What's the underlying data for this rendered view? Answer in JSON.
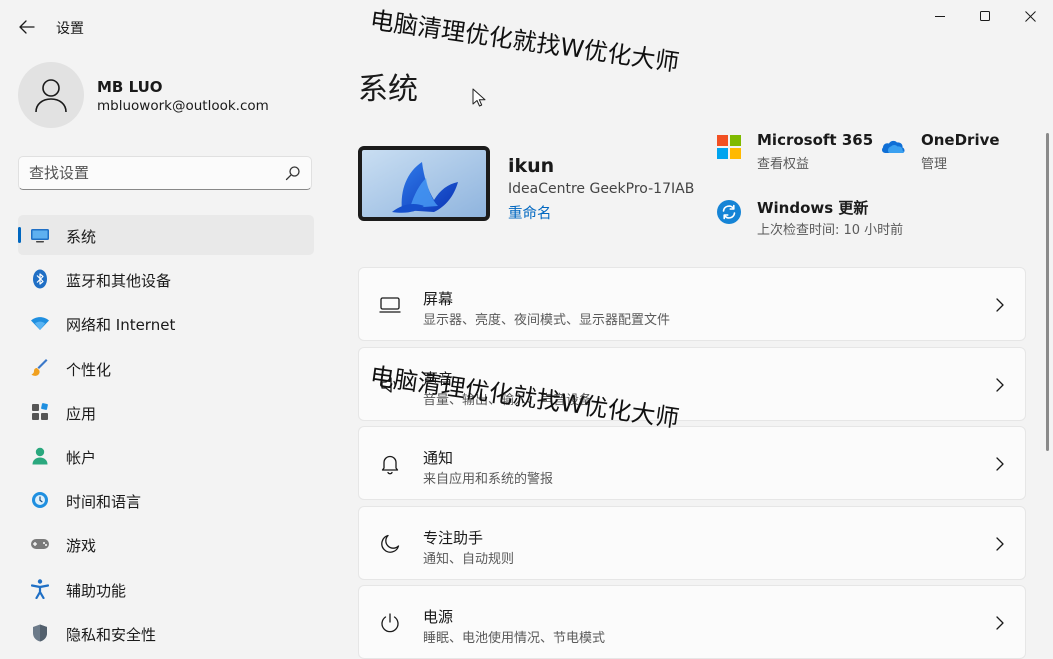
{
  "window": {
    "title": "设置"
  },
  "user": {
    "name": "MB LUO",
    "email": "mbluowork@outlook.com"
  },
  "search": {
    "placeholder": "查找设置"
  },
  "sidebar": {
    "items": [
      {
        "label": "系统",
        "icon": "monitor-icon"
      },
      {
        "label": "蓝牙和其他设备",
        "icon": "bluetooth-icon"
      },
      {
        "label": "网络和 Internet",
        "icon": "wifi-icon"
      },
      {
        "label": "个性化",
        "icon": "brush-icon"
      },
      {
        "label": "应用",
        "icon": "apps-icon"
      },
      {
        "label": "帐户",
        "icon": "person-icon"
      },
      {
        "label": "时间和语言",
        "icon": "globe-clock-icon"
      },
      {
        "label": "游戏",
        "icon": "gamepad-icon"
      },
      {
        "label": "辅助功能",
        "icon": "accessibility-icon"
      },
      {
        "label": "隐私和安全性",
        "icon": "shield-icon"
      }
    ]
  },
  "main": {
    "title": "系统",
    "device": {
      "name": "ikun",
      "model": "IdeaCentre GeekPro-17IAB",
      "rename": "重命名"
    },
    "tiles": {
      "microsoft365": {
        "title": "Microsoft 365",
        "subtitle": "查看权益"
      },
      "onedrive": {
        "title": "OneDrive",
        "subtitle": "管理"
      },
      "windows_update": {
        "title": "Windows 更新",
        "subtitle": "上次检查时间: 10 小时前"
      }
    },
    "cards": [
      {
        "title": "屏幕",
        "subtitle": "显示器、亮度、夜间模式、显示器配置文件",
        "icon": "display-icon"
      },
      {
        "title": "声音",
        "subtitle": "音量、输出、输入、声音设备",
        "icon": "speaker-icon"
      },
      {
        "title": "通知",
        "subtitle": "来自应用和系统的警报",
        "icon": "bell-icon"
      },
      {
        "title": "专注助手",
        "subtitle": "通知、自动规则",
        "icon": "moon-icon"
      },
      {
        "title": "电源",
        "subtitle": "睡眠、电池使用情况、节电模式",
        "icon": "power-icon"
      }
    ]
  },
  "watermark": {
    "text": "电脑清理优化就找W优化大师"
  },
  "colors": {
    "accent": "#0067c0",
    "background": "#f3f3f3",
    "card": "#fbfbfb"
  }
}
